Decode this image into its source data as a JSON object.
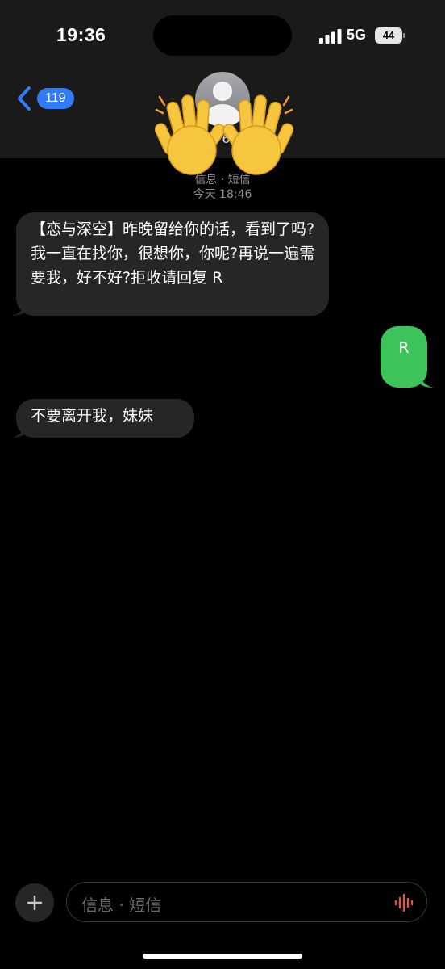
{
  "status_bar": {
    "time": "19:36",
    "network": "5G",
    "battery": "44"
  },
  "header": {
    "back_count": "119",
    "contact_partial": "76",
    "message_type": "信息 · 短信",
    "timestamp": "今天 18:46"
  },
  "messages": [
    {
      "direction": "incoming",
      "text": "【恋与深空】昨晚留给你的话，看到了吗?我一直在找你，很想你，你呢?再说一遍需要我，好不好?拒收请回复 R"
    },
    {
      "direction": "outgoing",
      "text": "R"
    },
    {
      "direction": "incoming",
      "text": "不要离开我，妹妹"
    }
  ],
  "composer": {
    "placeholder": "信息 · 短信"
  },
  "icons": {
    "back": "chevron-left-icon",
    "avatar": "person-avatar-icon",
    "hand": "raised-hands-emoji",
    "plus": "plus-icon",
    "mic": "audio-waveform-icon"
  },
  "colors": {
    "outgoing_bubble": "#3cc35a",
    "incoming_bubble": "#262628",
    "accent": "#2f7cf6"
  }
}
